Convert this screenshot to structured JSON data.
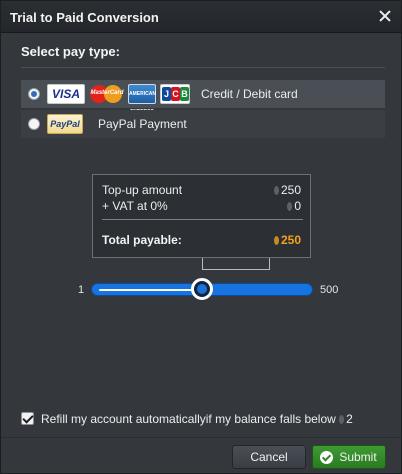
{
  "dialog": {
    "title": "Trial to Paid Conversion",
    "close_icon": "close-icon"
  },
  "pay_type": {
    "heading": "Select pay type:",
    "options": [
      {
        "label": "Credit / Debit card",
        "selected": true,
        "cards": [
          "VISA",
          "MasterCard",
          "AMERICAN EXPRESS",
          "JCB"
        ]
      },
      {
        "label": "PayPal Payment",
        "selected": false,
        "logo": "PayPal"
      }
    ]
  },
  "summary": {
    "topup_label": "Top-up amount",
    "topup_value": "250",
    "vat_label": "+ VAT at 0%",
    "vat_value": "0",
    "total_label": "Total payable:",
    "total_value": "250"
  },
  "slider": {
    "min_label": "1",
    "max_label": "500",
    "min": 1,
    "max": 500,
    "value": 250
  },
  "refill": {
    "checked": true,
    "label": "Refill my account automaticallyif my balance falls below",
    "threshold": "2"
  },
  "buttons": {
    "cancel": "Cancel",
    "submit": "Submit"
  },
  "colors": {
    "accent_blue": "#1673e0",
    "submit_green": "#2e8a25",
    "total_orange": "#f0a31e"
  }
}
